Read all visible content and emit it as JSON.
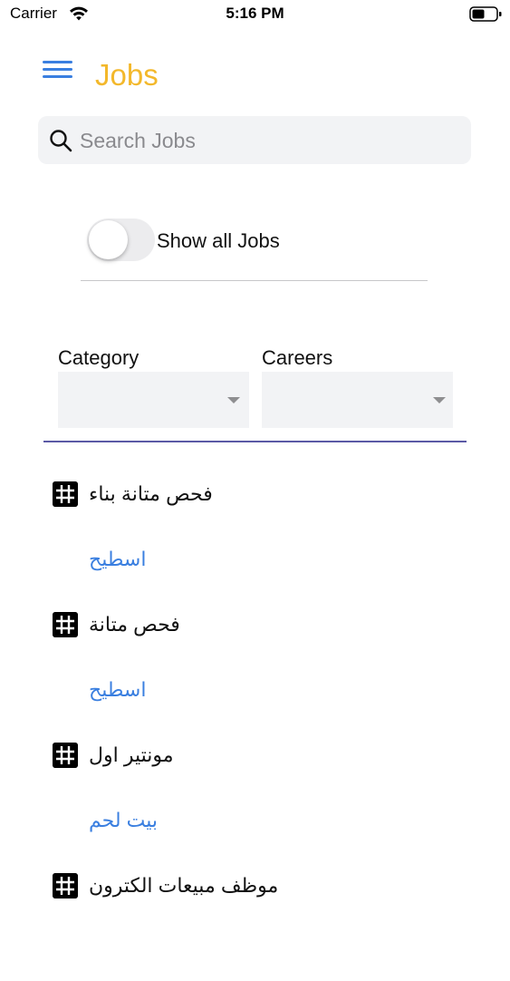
{
  "status_bar": {
    "carrier": "Carrier",
    "time": "5:16 PM",
    "wifi_icon": "wifi-icon",
    "battery_icon": "battery-icon"
  },
  "header": {
    "title": "Jobs",
    "title_color": "#f3b82b",
    "menu_icon": "hamburger-menu-icon",
    "accent_color": "#3a7fe0"
  },
  "search": {
    "placeholder": "Search Jobs",
    "value": "",
    "icon": "search-icon"
  },
  "toggle": {
    "label": "Show all Jobs",
    "checked": false
  },
  "filters": {
    "category": {
      "label": "Category",
      "selected": ""
    },
    "careers": {
      "label": "Careers",
      "selected": ""
    },
    "divider_color": "#5b5aa6"
  },
  "jobs": [
    {
      "title": "فحص متانة بناء",
      "location": "اسطيح",
      "icon": "hashtag-icon"
    },
    {
      "title": "فحص متانة",
      "location": "اسطيح",
      "icon": "hashtag-icon"
    },
    {
      "title": "مونتير اول",
      "location": "بيت لحم",
      "icon": "hashtag-icon"
    },
    {
      "title": "موظف مبيعات الكترون",
      "location": "",
      "icon": "hashtag-icon"
    }
  ]
}
